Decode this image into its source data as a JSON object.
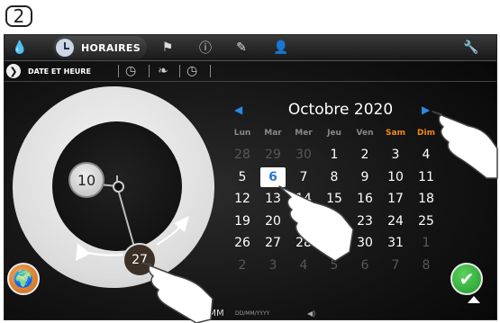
{
  "step": {
    "number": "2"
  },
  "tabs": [
    {
      "name": "water",
      "icon": "water-drop-icon",
      "glyph": "💧"
    },
    {
      "name": "horaires",
      "icon": "clock-icon",
      "label": "HORAIRES"
    },
    {
      "name": "flag",
      "icon": "flag-icon",
      "glyph": "⚑"
    },
    {
      "name": "info",
      "icon": "info-icon",
      "glyph": "ⓘ"
    },
    {
      "name": "edit",
      "icon": "pencil-icon",
      "glyph": "✎"
    },
    {
      "name": "user",
      "icon": "user-badge-icon",
      "glyph": "👤"
    },
    {
      "name": "settings",
      "icon": "wrench-icon",
      "glyph": "🔧"
    }
  ],
  "subtabs": {
    "active_label": "DATE ET HEURE",
    "items": [
      {
        "icon": "clock-timer-icon",
        "glyph": "◷"
      },
      {
        "icon": "leaf-icon",
        "glyph": "❧"
      },
      {
        "icon": "clock-plus-icon",
        "glyph": "◷"
      }
    ]
  },
  "clock": {
    "hour": "10",
    "minutes": "27"
  },
  "calendar": {
    "month_title": "Octobre 2020",
    "weekdays": [
      "Lun",
      "Mar",
      "Mer",
      "Jeu",
      "Ven",
      "Sam",
      "Dim"
    ],
    "weekend_color": "#f08a1c",
    "selected_day": "6",
    "weeks": [
      [
        "28",
        "29",
        "30",
        "1",
        "2",
        "3",
        "4"
      ],
      [
        "5",
        "6",
        "7",
        "8",
        "9",
        "10",
        "11"
      ],
      [
        "12",
        "13",
        "14",
        "15",
        "16",
        "17",
        "18"
      ],
      [
        "19",
        "20",
        "21",
        "22",
        "23",
        "24",
        "25"
      ],
      [
        "26",
        "27",
        "28",
        "29",
        "30",
        "31",
        "1"
      ],
      [
        "2",
        "3",
        "4",
        "5",
        "6",
        "7",
        "8"
      ]
    ],
    "dimmed": [
      [
        true,
        true,
        true,
        false,
        false,
        false,
        false
      ],
      [
        false,
        false,
        false,
        false,
        false,
        false,
        false
      ],
      [
        false,
        false,
        false,
        false,
        false,
        false,
        false
      ],
      [
        false,
        false,
        false,
        false,
        false,
        false,
        false
      ],
      [
        false,
        false,
        false,
        false,
        false,
        false,
        true
      ],
      [
        true,
        true,
        true,
        true,
        true,
        true,
        true
      ]
    ]
  },
  "footer": {
    "time_format": "HH:MM",
    "date_format": "DD/MM/YYYY"
  },
  "colors": {
    "accent_blue": "#2a8be6",
    "ok_green": "#22a635",
    "globe_orange": "#e08a2e"
  }
}
